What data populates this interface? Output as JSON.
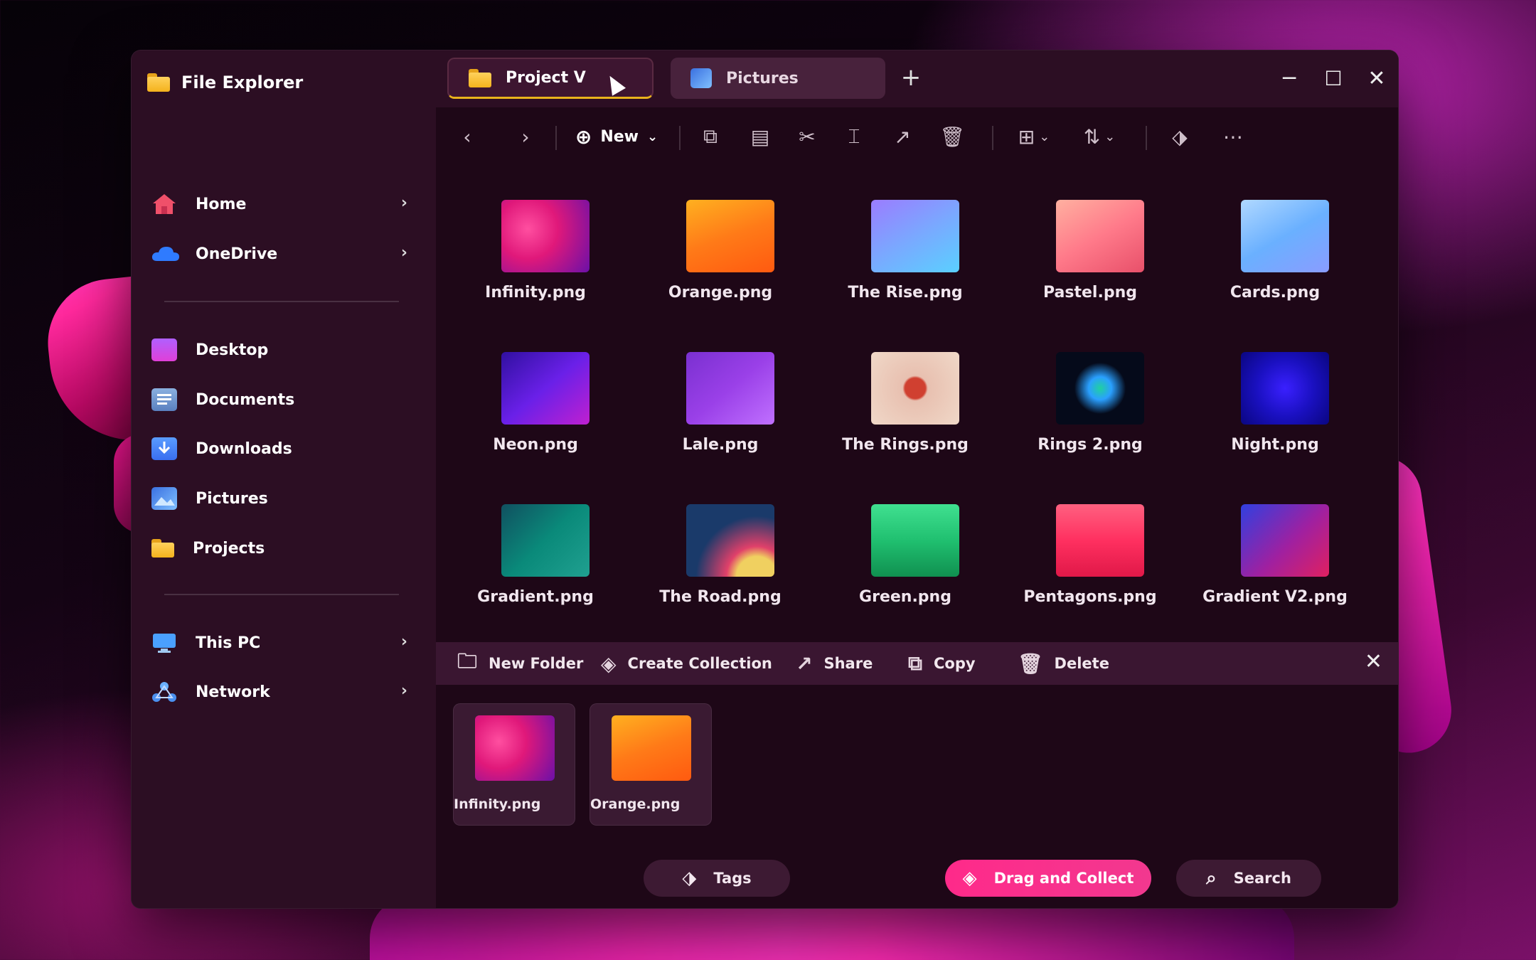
{
  "app": {
    "title": "File Explorer"
  },
  "tabs": [
    {
      "label": "Project V",
      "active": true,
      "icon": "folder-icon"
    },
    {
      "label": "Pictures",
      "active": false,
      "icon": "pictures-icon"
    }
  ],
  "window_controls": {
    "minimize": "─",
    "maximize": "☐",
    "close": "✕",
    "new_tab": "+"
  },
  "sidebar": {
    "items": [
      {
        "label": "Home",
        "icon": "home-icon",
        "expandable": true
      },
      {
        "label": "OneDrive",
        "icon": "cloud-icon",
        "expandable": true
      },
      {
        "label": "Desktop",
        "icon": "desktop-icon",
        "expandable": false
      },
      {
        "label": "Documents",
        "icon": "documents-icon",
        "expandable": false
      },
      {
        "label": "Downloads",
        "icon": "downloads-icon",
        "expandable": false
      },
      {
        "label": "Pictures",
        "icon": "pictures-icon",
        "expandable": false
      },
      {
        "label": "Projects",
        "icon": "folder-icon",
        "expandable": false
      },
      {
        "label": "This PC",
        "icon": "pc-icon",
        "expandable": true
      },
      {
        "label": "Network",
        "icon": "network-icon",
        "expandable": true
      }
    ]
  },
  "toolbar": {
    "new_label": "New",
    "icons": [
      "back-icon",
      "forward-icon",
      "new-icon",
      "copy-icon",
      "paste-icon",
      "cut-icon",
      "rename-icon",
      "share-icon",
      "delete-icon",
      "view-icon",
      "sort-icon",
      "tag-icon",
      "more-icon"
    ]
  },
  "files": [
    {
      "name": "Infinity.png",
      "colors": [
        "#e0187a",
        "#6a10a8",
        "#ff4fa0"
      ]
    },
    {
      "name": "Orange.png",
      "colors": [
        "#ff7a18",
        "#ffb020",
        "#ff5a10"
      ]
    },
    {
      "name": "The Rise.png",
      "colors": [
        "#7aa8ff",
        "#5ad0ff",
        "#9b7cff"
      ]
    },
    {
      "name": "Pastel.png",
      "colors": [
        "#ff7a8a",
        "#e8506a",
        "#ffb0a0"
      ]
    },
    {
      "name": "Cards.png",
      "colors": [
        "#6ab0ff",
        "#8a9cff",
        "#b0d8ff"
      ]
    },
    {
      "name": "Neon.png",
      "colors": [
        "#6a20e8",
        "#c020d0",
        "#3010a0"
      ]
    },
    {
      "name": "Lale.png",
      "colors": [
        "#9a40e8",
        "#c070ff",
        "#7a30d0"
      ]
    },
    {
      "name": "The Rings.png",
      "colors": [
        "#e8c0b0",
        "#d04030",
        "#f0d8c8"
      ]
    },
    {
      "name": "Rings 2.png",
      "colors": [
        "#050a1a",
        "#2aa0ff",
        "#20d0a0"
      ]
    },
    {
      "name": "Night.png",
      "colors": [
        "#1a10c0",
        "#3a20ff",
        "#0a0680"
      ]
    },
    {
      "name": "Gradient.png",
      "colors": [
        "#0a8a7a",
        "#20a090",
        "#105060"
      ]
    },
    {
      "name": "The Road.png",
      "colors": [
        "#1a3a6a",
        "#e0406a",
        "#f0d060"
      ]
    },
    {
      "name": "Green.png",
      "colors": [
        "#20c070",
        "#40e090",
        "#109050"
      ]
    },
    {
      "name": "Pentagons.png",
      "colors": [
        "#ff3060",
        "#e01848",
        "#ff6080"
      ]
    },
    {
      "name": "Gradient V2.png",
      "colors": [
        "#3040e0",
        "#a020a0",
        "#e02060"
      ]
    }
  ],
  "action_bar": {
    "items": [
      {
        "label": "New Folder",
        "icon": "new-folder-icon"
      },
      {
        "label": "Create Collection",
        "icon": "collection-icon"
      },
      {
        "label": "Share",
        "icon": "share-icon"
      },
      {
        "label": "Copy",
        "icon": "copy-icon"
      },
      {
        "label": "Delete",
        "icon": "delete-icon"
      }
    ]
  },
  "collection": [
    {
      "name": "Infinity.png",
      "colors": [
        "#e0187a",
        "#6a10a8",
        "#ff4fa0"
      ]
    },
    {
      "name": "Orange.png",
      "colors": [
        "#ff7a18",
        "#ffb020",
        "#ff5a10"
      ]
    }
  ],
  "bottom_bar": {
    "items": [
      {
        "label": "Tags",
        "icon": "tag-icon",
        "active": false
      },
      {
        "label": "Drag and Collect",
        "icon": "collection-icon",
        "active": true
      },
      {
        "label": "Search",
        "icon": "search-icon",
        "active": false
      }
    ]
  }
}
